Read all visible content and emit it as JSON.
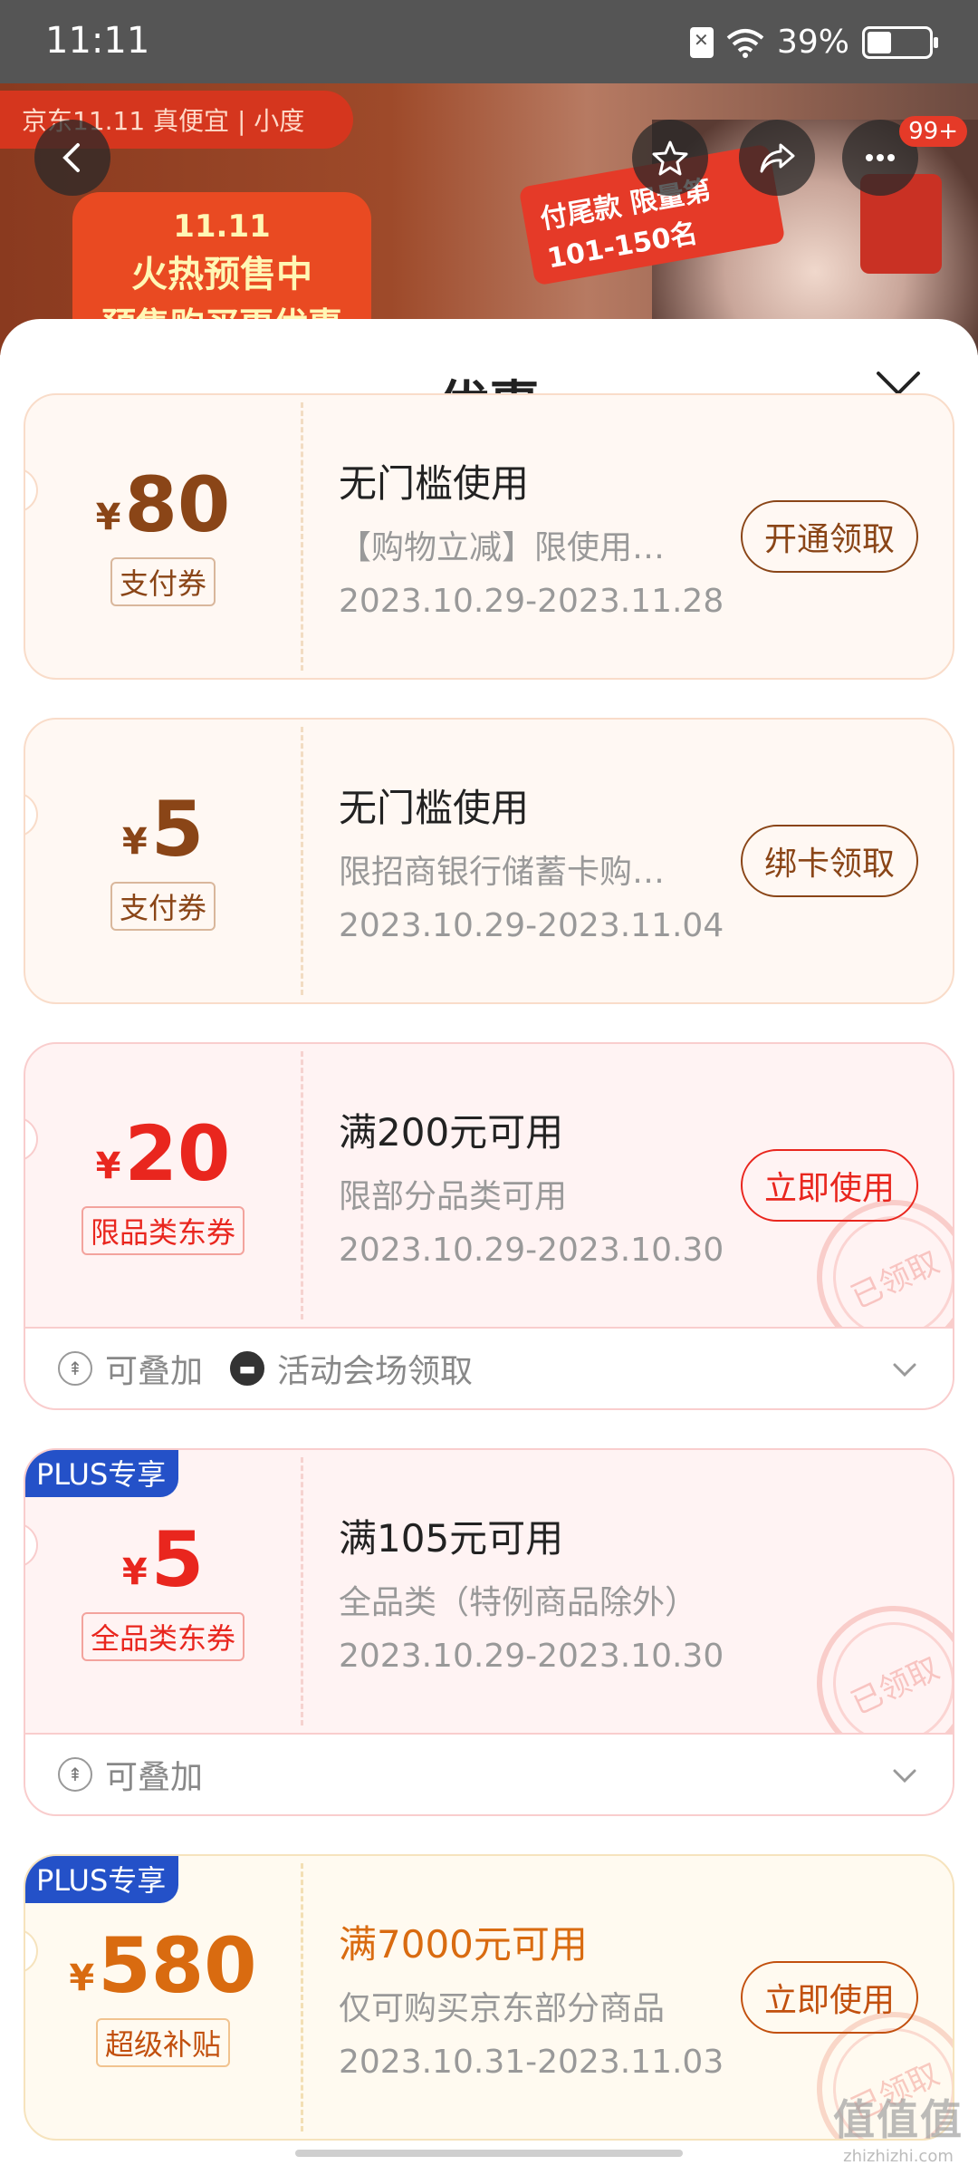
{
  "status_bar": {
    "time": "11:11",
    "battery": "39%",
    "battery_level": 0.39
  },
  "banner": {
    "pill_text": "京东11.11 真便宜 | 小度",
    "promo_line1": "11.11",
    "promo_line2": "火热预售中",
    "promo_line3": "预售购买更优惠",
    "tag_text": "付尾款 限量第101-150名",
    "more_badge": "99+"
  },
  "sheet": {
    "title": "优惠"
  },
  "coupons": [
    {
      "yen": "¥",
      "amount": "80",
      "type": "支付券",
      "title": "无门槛使用",
      "desc": "【购物立减】限使用…",
      "date": "2023.10.29-2023.11.28",
      "button": "开通领取"
    },
    {
      "yen": "¥",
      "amount": "5",
      "type": "支付券",
      "title": "无门槛使用",
      "desc": "限招商银行储蓄卡购…",
      "date": "2023.10.29-2023.11.04",
      "button": "绑卡领取"
    },
    {
      "yen": "¥",
      "amount": "20",
      "type": "限品类东券",
      "title": "满200元可用",
      "desc": "限部分品类可用",
      "date": "2023.10.29-2023.10.30",
      "button": "立即使用",
      "stamp": "已领取",
      "foot1": "可叠加",
      "foot2": "活动会场领取"
    },
    {
      "plus": "PLUS专享",
      "yen": "¥",
      "amount": "5",
      "type": "全品类东券",
      "title": "满105元可用",
      "desc": "全品类（特例商品除外）",
      "date": "2023.10.29-2023.10.30",
      "stamp": "已领取",
      "foot1": "可叠加"
    },
    {
      "plus": "PLUS专享",
      "yen": "¥",
      "amount": "580",
      "type": "超级补贴",
      "title": "满7000元可用",
      "desc": "仅可购买京东部分商品",
      "date": "2023.10.31-2023.11.03",
      "button": "立即使用",
      "stamp": "已领取"
    }
  ],
  "watermark": {
    "line1": "值值值",
    "line2": "zhizhizhi.com"
  }
}
